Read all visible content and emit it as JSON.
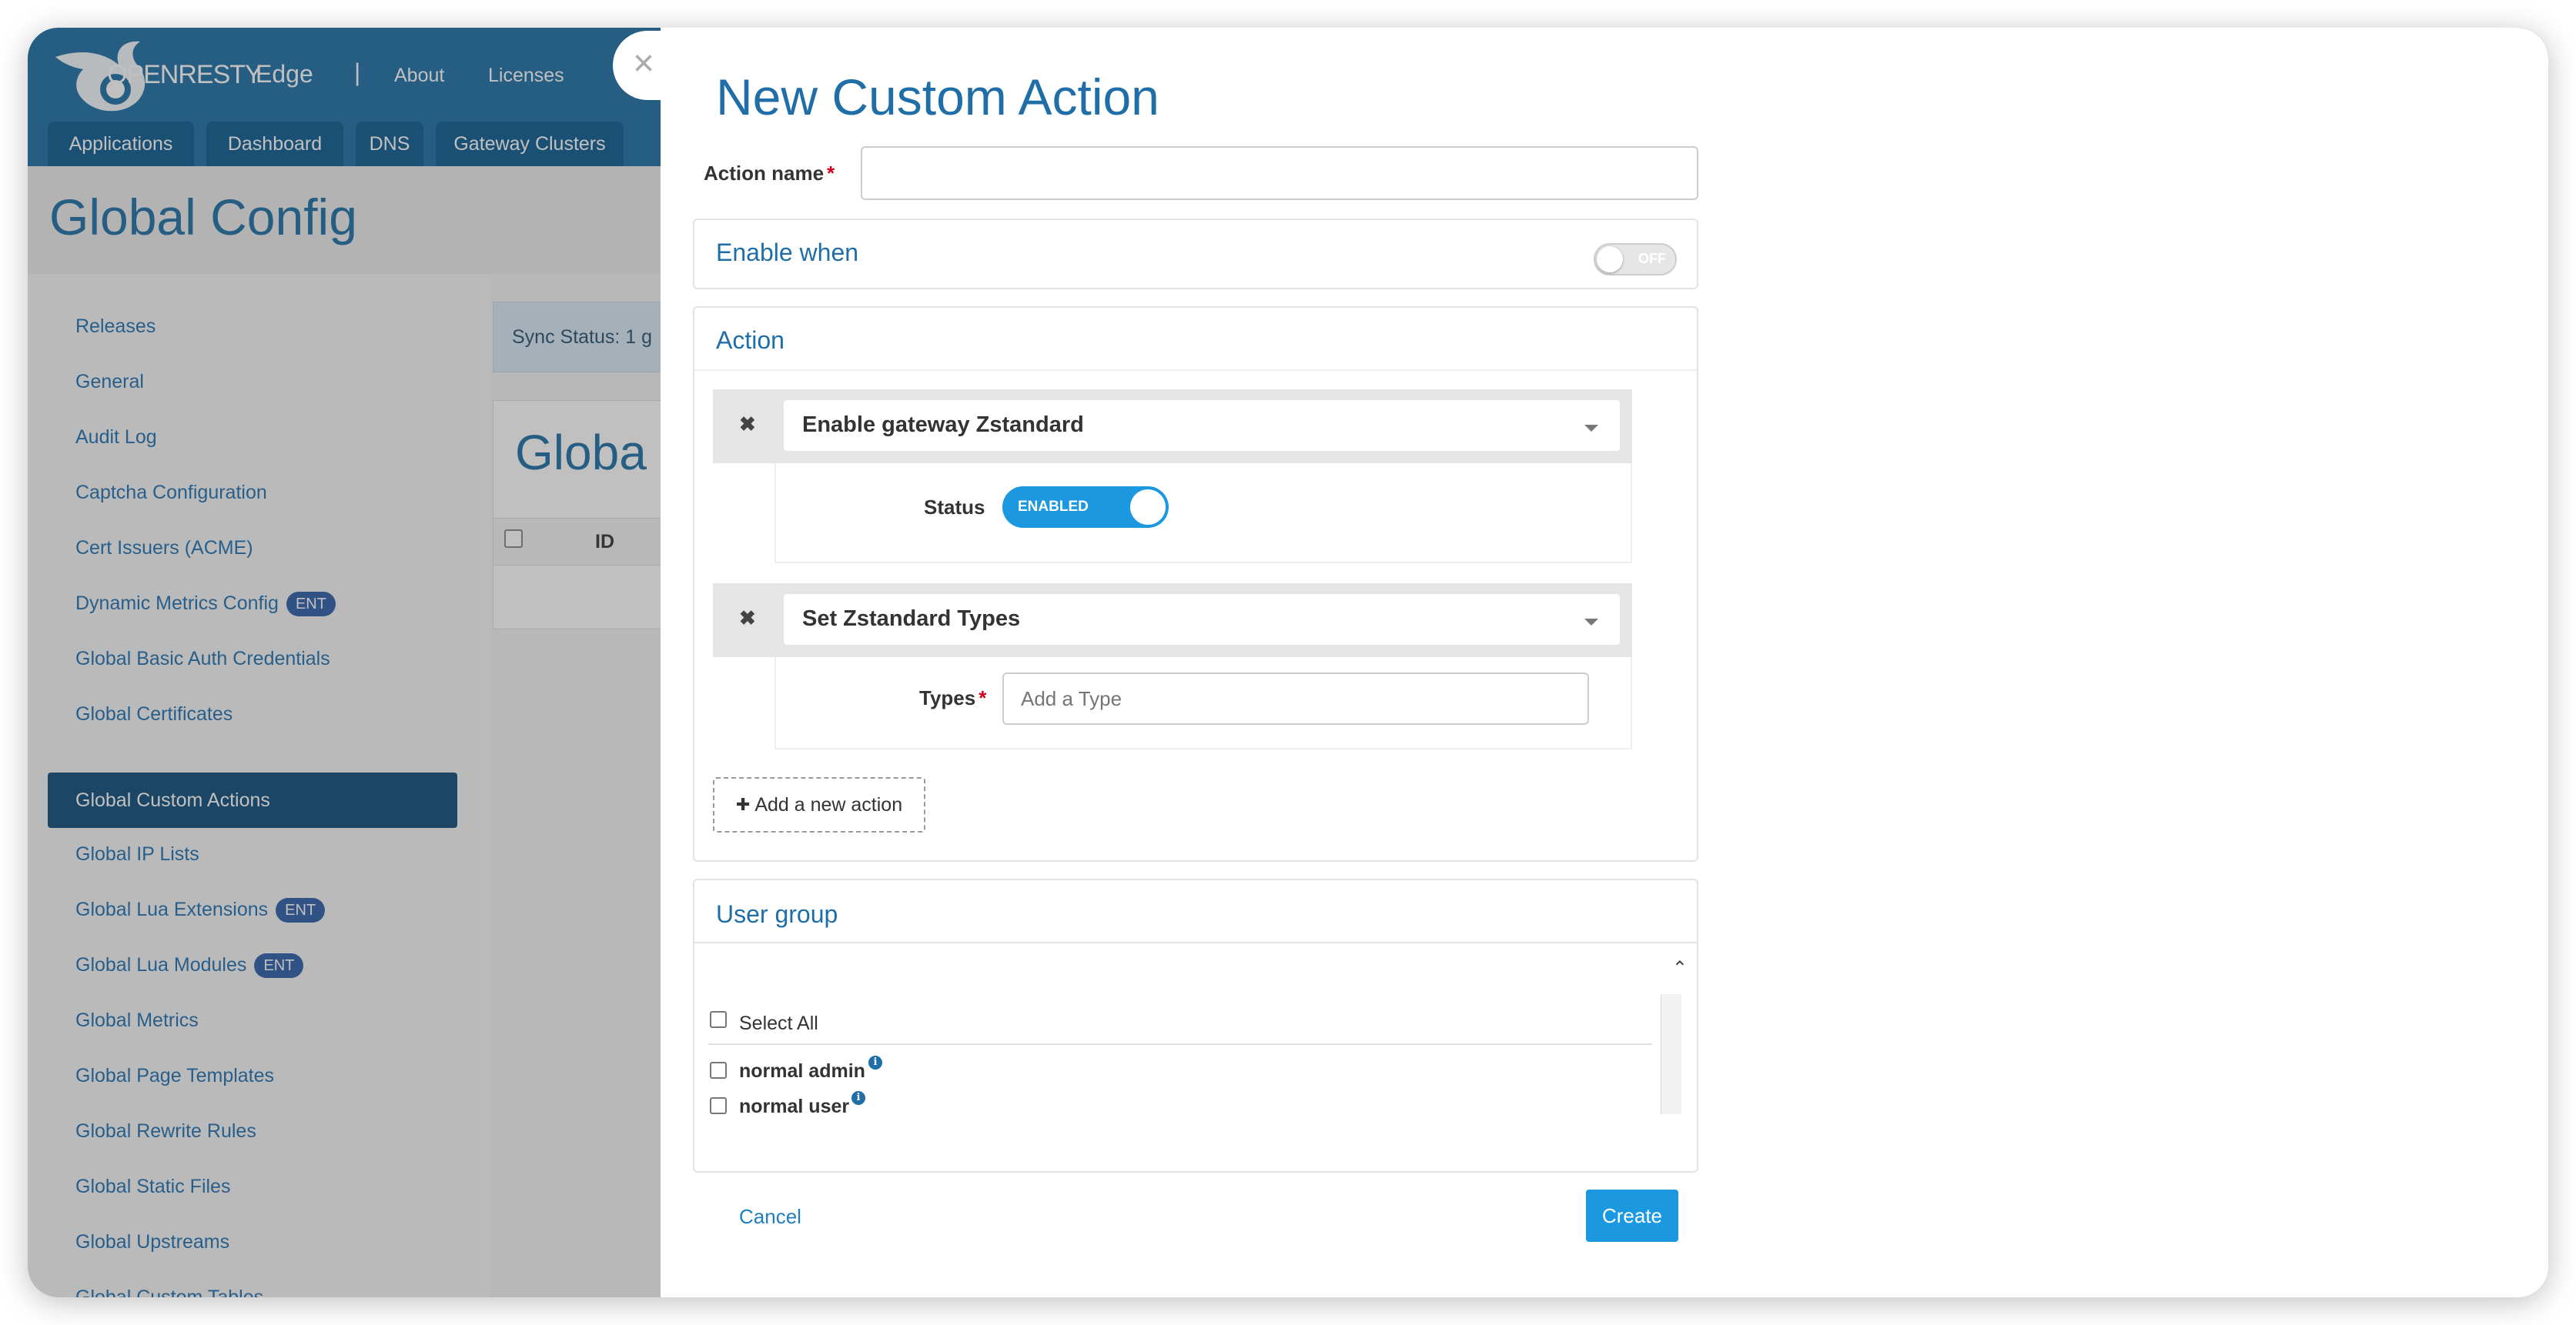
{
  "app": {
    "brand": "OPENRESTY",
    "product": "Edge",
    "separator": "|",
    "top_nav": [
      "About",
      "Licenses"
    ],
    "tabs": [
      "Applications",
      "Dashboard",
      "DNS",
      "Gateway Clusters"
    ],
    "page_title": "Global Config",
    "sync_status": "Sync Status:   1 g",
    "card_title": "Globa",
    "table_col_id": "ID",
    "sidebar": [
      {
        "label": "Releases"
      },
      {
        "label": "General"
      },
      {
        "label": "Audit Log"
      },
      {
        "label": "Captcha Configuration"
      },
      {
        "label": "Cert Issuers (ACME)"
      },
      {
        "label": "Dynamic Metrics Config",
        "badge": "ENT"
      },
      {
        "label": "Global Basic Auth Credentials"
      },
      {
        "label": "Global Certificates"
      },
      {
        "label": "Global Custom Actions",
        "active": true
      },
      {
        "label": "Global IP Lists"
      },
      {
        "label": "Global Lua Extensions",
        "badge": "ENT"
      },
      {
        "label": "Global Lua Modules",
        "badge": "ENT"
      },
      {
        "label": "Global Metrics"
      },
      {
        "label": "Global Page Templates"
      },
      {
        "label": "Global Rewrite Rules"
      },
      {
        "label": "Global Static Files"
      },
      {
        "label": "Global Upstreams"
      },
      {
        "label": "Global Custom Tables"
      }
    ]
  },
  "modal": {
    "close_glyph": "×",
    "title": "New Custom Action",
    "action_name": {
      "label": "Action name",
      "required": "*",
      "value": ""
    },
    "enable_when": {
      "title": "Enable when",
      "toggle_text": "OFF",
      "enabled": false
    },
    "action_section": {
      "title": "Action",
      "actions": [
        {
          "remove": "✖",
          "selected": "Enable gateway Zstandard",
          "field_label": "Status",
          "toggle_text": "ENABLED"
        },
        {
          "remove": "✖",
          "selected": "Set Zstandard Types",
          "field_label": "Types",
          "required": "*",
          "placeholder": "Add a Type"
        }
      ],
      "add_button": "Add a new action",
      "add_icon": "✚"
    },
    "user_group": {
      "title": "User group",
      "collapse_glyph": "⌃",
      "select_all": "Select All",
      "groups": [
        "normal admin",
        "normal user"
      ],
      "info_glyph": "i"
    },
    "cancel_label": "Cancel",
    "create_label": "Create"
  }
}
